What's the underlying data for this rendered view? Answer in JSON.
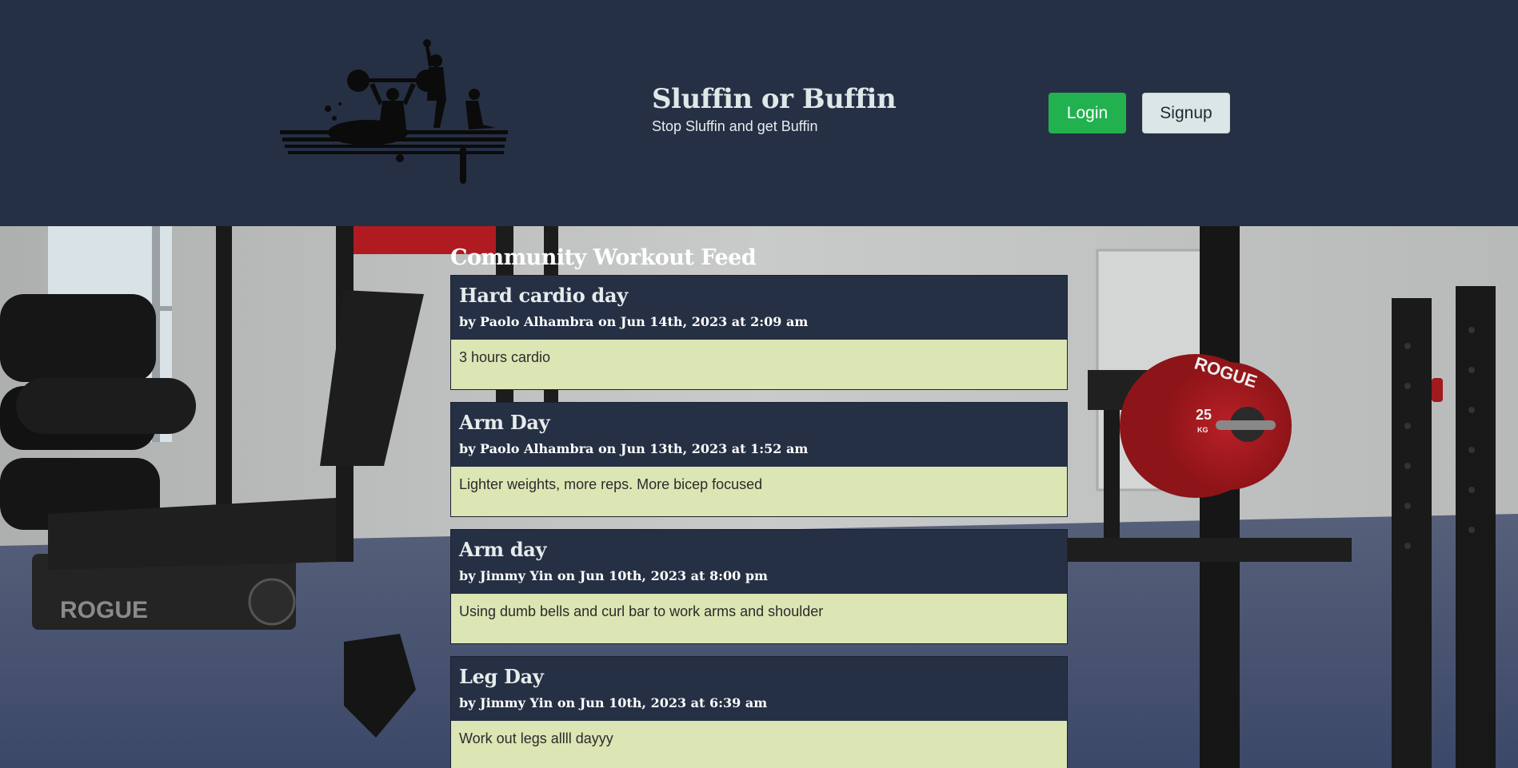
{
  "header": {
    "title": "Sluffin or Buffin",
    "subtitle": "Stop Sluffin and get Buffin",
    "login_label": "Login",
    "signup_label": "Signup"
  },
  "feed": {
    "title": "Community Workout Feed",
    "posts": [
      {
        "title": "Hard cardio day",
        "meta": "by Paolo Alhambra on Jun 14th, 2023 at 2:09 am",
        "body": "3 hours cardio"
      },
      {
        "title": "Arm Day",
        "meta": "by Paolo Alhambra on Jun 13th, 2023 at 1:52 am",
        "body": "Lighter weights, more reps. More bicep focused"
      },
      {
        "title": "Arm day",
        "meta": "by Jimmy Yin on Jun 10th, 2023 at 8:00 pm",
        "body": "Using dumb bells and curl bar to work arms and shoulder"
      },
      {
        "title": "Leg Day",
        "meta": "by Jimmy Yin on Jun 10th, 2023 at 6:39 am",
        "body": "Work out legs allll dayyy"
      }
    ]
  },
  "background": {
    "plate_text": "ROGUE",
    "plate_weight": "25",
    "plate_unit": "KG",
    "bench_brand": "ROGUE"
  }
}
